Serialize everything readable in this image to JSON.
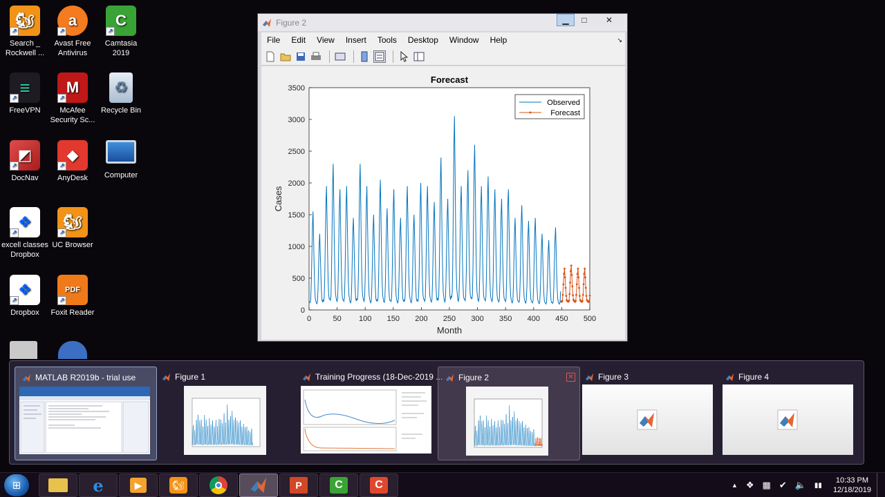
{
  "desktop_icons": [
    {
      "label": "Search _ Rockwell ...",
      "icon": "uc-browser-icon"
    },
    {
      "label": "Avast Free Antivirus",
      "icon": "avast-icon"
    },
    {
      "label": "Camtasia 2019",
      "icon": "camtasia-icon"
    },
    {
      "label": "FreeVPN",
      "icon": "freevpn-icon"
    },
    {
      "label": "McAfee Security Sc...",
      "icon": "mcafee-icon"
    },
    {
      "label": "Recycle Bin",
      "icon": "recycle-bin-icon"
    },
    {
      "label": "DocNav",
      "icon": "docnav-icon"
    },
    {
      "label": "AnyDesk",
      "icon": "anydesk-icon"
    },
    {
      "label": "Computer",
      "icon": "computer-icon"
    },
    {
      "label": "excell classes Dropbox",
      "icon": "dropbox-icon"
    },
    {
      "label": "UC Browser",
      "icon": "uc-browser-icon"
    },
    {
      "label": "Dropbox",
      "icon": "dropbox-icon"
    },
    {
      "label": "Foxit Reader",
      "icon": "foxit-reader-icon"
    }
  ],
  "figure_window": {
    "title": "Figure 2",
    "menu": [
      "File",
      "Edit",
      "View",
      "Insert",
      "Tools",
      "Desktop",
      "Window",
      "Help"
    ],
    "undock_glyph": "↘",
    "min_glyph": "▁",
    "max_glyph": "□",
    "close_glyph": "✕"
  },
  "chart_data": {
    "type": "line",
    "title": "Forecast",
    "xlabel": "Month",
    "ylabel": "Cases",
    "xlim": [
      0,
      500
    ],
    "ylim": [
      0,
      3500
    ],
    "xticks": [
      0,
      50,
      100,
      150,
      200,
      250,
      300,
      350,
      400,
      450,
      500
    ],
    "yticks": [
      0,
      500,
      1000,
      1500,
      2000,
      2500,
      3000,
      3500
    ],
    "grid": false,
    "legend_position": "top-right",
    "series": [
      {
        "name": "Observed",
        "color": "#0072BD",
        "cycle_length": 12,
        "x_start": 1,
        "x_end": 448,
        "peaks": [
          1550,
          1200,
          1950,
          2300,
          1900,
          1950,
          1450,
          2300,
          1950,
          1500,
          2050,
          1600,
          1900,
          1450,
          1950,
          1500,
          2000,
          1950,
          1700,
          2400,
          1750,
          3050,
          1950,
          2200,
          2600,
          1950,
          2100,
          1900,
          1750,
          1900,
          1450,
          1650,
          1400,
          1450,
          1200,
          1100,
          1300,
          1050
        ]
      },
      {
        "name": "Forecast",
        "color": "#D95319",
        "cycle_length": 12,
        "x_start": 449,
        "x_end": 500,
        "peaks": [
          650,
          700,
          650,
          650,
          600
        ]
      }
    ]
  },
  "switcher": {
    "windows": [
      {
        "title": "MATLAB R2019b - trial use",
        "state": "active"
      },
      {
        "title": "Figure 1",
        "state": "normal"
      },
      {
        "title": "Training Progress (18-Dec-2019 ...",
        "state": "normal"
      },
      {
        "title": "Figure 2",
        "state": "hover"
      },
      {
        "title": "Figure 3",
        "state": "normal"
      },
      {
        "title": "Figure 4",
        "state": "normal"
      }
    ],
    "close_glyph": "✕"
  },
  "taskbar": {
    "apps": [
      "explorer",
      "internet-explorer",
      "media-player",
      "uc-browser",
      "chrome",
      "matlab",
      "powerpoint",
      "camtasia",
      "camtasia-recorder"
    ],
    "active_app": "matlab",
    "tray_glyphs": [
      "▲",
      "❖",
      "▦",
      "✔",
      "🔈",
      "▮▮"
    ],
    "time": "10:33 PM",
    "date": "12/18/2019"
  }
}
